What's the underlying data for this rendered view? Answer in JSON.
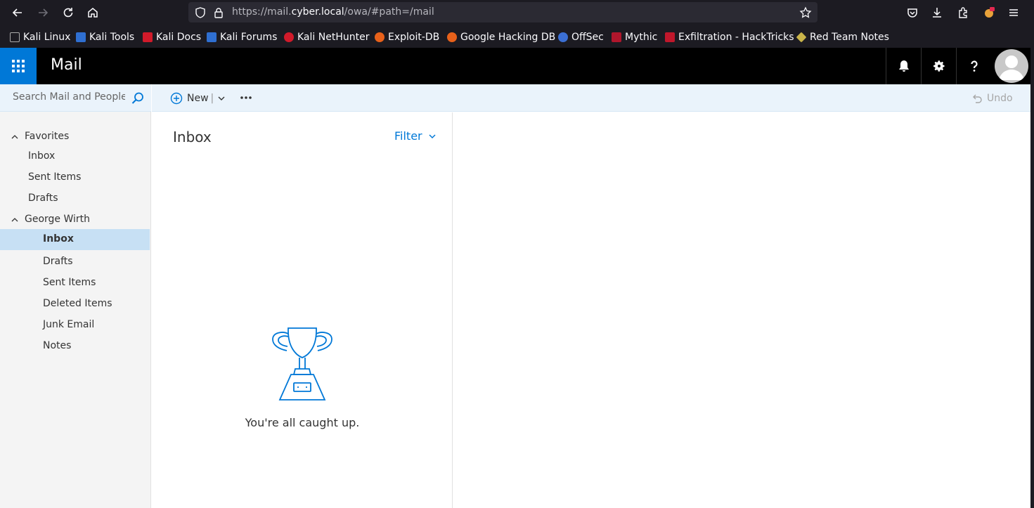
{
  "browser": {
    "url_prefix": "https://mail.",
    "url_host": "cyber.local",
    "url_path": "/owa/#path=/mail"
  },
  "bookmarks": [
    {
      "label": "Kali Linux",
      "color": "#1a1a1a"
    },
    {
      "label": "Kali Tools",
      "color": "#2f6fd1"
    },
    {
      "label": "Kali Docs",
      "color": "#d11a2a"
    },
    {
      "label": "Kali Forums",
      "color": "#2f6fd1"
    },
    {
      "label": "Kali NetHunter",
      "color": "#d11a2a"
    },
    {
      "label": "Exploit-DB",
      "color": "#e8611a"
    },
    {
      "label": "Google Hacking DB",
      "color": "#e8611a"
    },
    {
      "label": "OffSec",
      "color": "#3b6fd4"
    },
    {
      "label": "Mythic",
      "color": "#b0162c"
    },
    {
      "label": "Exfiltration - HackTricks",
      "color": "#c0172b"
    },
    {
      "label": "Red Team Notes",
      "color": "#c9b44a"
    }
  ],
  "header": {
    "app_title": "Mail"
  },
  "search": {
    "placeholder": "Search Mail and People"
  },
  "nav": {
    "favorites_label": "Favorites",
    "favorites": [
      "Inbox",
      "Sent Items",
      "Drafts"
    ],
    "account_label": "George Wirth",
    "folders": [
      "Inbox",
      "Drafts",
      "Sent Items",
      "Deleted Items",
      "Junk Email",
      "Notes"
    ],
    "selected_folder": "Inbox"
  },
  "commands": {
    "new_label": "New",
    "undo_label": "Undo"
  },
  "list": {
    "title": "Inbox",
    "filter_label": "Filter",
    "empty_message": "You're all caught up."
  },
  "colors": {
    "accent": "#0078d7",
    "selected_bg": "#c7e0f4",
    "command_bar_bg": "#eaf3fb"
  }
}
